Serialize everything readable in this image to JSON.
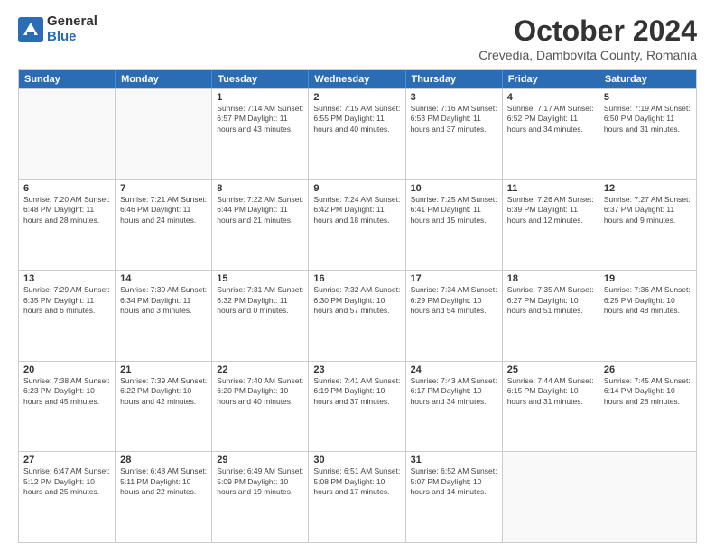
{
  "logo": {
    "general": "General",
    "blue": "Blue"
  },
  "title": "October 2024",
  "location": "Crevedia, Dambovita County, Romania",
  "days": [
    "Sunday",
    "Monday",
    "Tuesday",
    "Wednesday",
    "Thursday",
    "Friday",
    "Saturday"
  ],
  "weeks": [
    [
      {
        "day": "",
        "info": ""
      },
      {
        "day": "",
        "info": ""
      },
      {
        "day": "1",
        "info": "Sunrise: 7:14 AM\nSunset: 6:57 PM\nDaylight: 11 hours and 43 minutes."
      },
      {
        "day": "2",
        "info": "Sunrise: 7:15 AM\nSunset: 6:55 PM\nDaylight: 11 hours and 40 minutes."
      },
      {
        "day": "3",
        "info": "Sunrise: 7:16 AM\nSunset: 6:53 PM\nDaylight: 11 hours and 37 minutes."
      },
      {
        "day": "4",
        "info": "Sunrise: 7:17 AM\nSunset: 6:52 PM\nDaylight: 11 hours and 34 minutes."
      },
      {
        "day": "5",
        "info": "Sunrise: 7:19 AM\nSunset: 6:50 PM\nDaylight: 11 hours and 31 minutes."
      }
    ],
    [
      {
        "day": "6",
        "info": "Sunrise: 7:20 AM\nSunset: 6:48 PM\nDaylight: 11 hours and 28 minutes."
      },
      {
        "day": "7",
        "info": "Sunrise: 7:21 AM\nSunset: 6:46 PM\nDaylight: 11 hours and 24 minutes."
      },
      {
        "day": "8",
        "info": "Sunrise: 7:22 AM\nSunset: 6:44 PM\nDaylight: 11 hours and 21 minutes."
      },
      {
        "day": "9",
        "info": "Sunrise: 7:24 AM\nSunset: 6:42 PM\nDaylight: 11 hours and 18 minutes."
      },
      {
        "day": "10",
        "info": "Sunrise: 7:25 AM\nSunset: 6:41 PM\nDaylight: 11 hours and 15 minutes."
      },
      {
        "day": "11",
        "info": "Sunrise: 7:26 AM\nSunset: 6:39 PM\nDaylight: 11 hours and 12 minutes."
      },
      {
        "day": "12",
        "info": "Sunrise: 7:27 AM\nSunset: 6:37 PM\nDaylight: 11 hours and 9 minutes."
      }
    ],
    [
      {
        "day": "13",
        "info": "Sunrise: 7:29 AM\nSunset: 6:35 PM\nDaylight: 11 hours and 6 minutes."
      },
      {
        "day": "14",
        "info": "Sunrise: 7:30 AM\nSunset: 6:34 PM\nDaylight: 11 hours and 3 minutes."
      },
      {
        "day": "15",
        "info": "Sunrise: 7:31 AM\nSunset: 6:32 PM\nDaylight: 11 hours and 0 minutes."
      },
      {
        "day": "16",
        "info": "Sunrise: 7:32 AM\nSunset: 6:30 PM\nDaylight: 10 hours and 57 minutes."
      },
      {
        "day": "17",
        "info": "Sunrise: 7:34 AM\nSunset: 6:29 PM\nDaylight: 10 hours and 54 minutes."
      },
      {
        "day": "18",
        "info": "Sunrise: 7:35 AM\nSunset: 6:27 PM\nDaylight: 10 hours and 51 minutes."
      },
      {
        "day": "19",
        "info": "Sunrise: 7:36 AM\nSunset: 6:25 PM\nDaylight: 10 hours and 48 minutes."
      }
    ],
    [
      {
        "day": "20",
        "info": "Sunrise: 7:38 AM\nSunset: 6:23 PM\nDaylight: 10 hours and 45 minutes."
      },
      {
        "day": "21",
        "info": "Sunrise: 7:39 AM\nSunset: 6:22 PM\nDaylight: 10 hours and 42 minutes."
      },
      {
        "day": "22",
        "info": "Sunrise: 7:40 AM\nSunset: 6:20 PM\nDaylight: 10 hours and 40 minutes."
      },
      {
        "day": "23",
        "info": "Sunrise: 7:41 AM\nSunset: 6:19 PM\nDaylight: 10 hours and 37 minutes."
      },
      {
        "day": "24",
        "info": "Sunrise: 7:43 AM\nSunset: 6:17 PM\nDaylight: 10 hours and 34 minutes."
      },
      {
        "day": "25",
        "info": "Sunrise: 7:44 AM\nSunset: 6:15 PM\nDaylight: 10 hours and 31 minutes."
      },
      {
        "day": "26",
        "info": "Sunrise: 7:45 AM\nSunset: 6:14 PM\nDaylight: 10 hours and 28 minutes."
      }
    ],
    [
      {
        "day": "27",
        "info": "Sunrise: 6:47 AM\nSunset: 5:12 PM\nDaylight: 10 hours and 25 minutes."
      },
      {
        "day": "28",
        "info": "Sunrise: 6:48 AM\nSunset: 5:11 PM\nDaylight: 10 hours and 22 minutes."
      },
      {
        "day": "29",
        "info": "Sunrise: 6:49 AM\nSunset: 5:09 PM\nDaylight: 10 hours and 19 minutes."
      },
      {
        "day": "30",
        "info": "Sunrise: 6:51 AM\nSunset: 5:08 PM\nDaylight: 10 hours and 17 minutes."
      },
      {
        "day": "31",
        "info": "Sunrise: 6:52 AM\nSunset: 5:07 PM\nDaylight: 10 hours and 14 minutes."
      },
      {
        "day": "",
        "info": ""
      },
      {
        "day": "",
        "info": ""
      }
    ]
  ]
}
